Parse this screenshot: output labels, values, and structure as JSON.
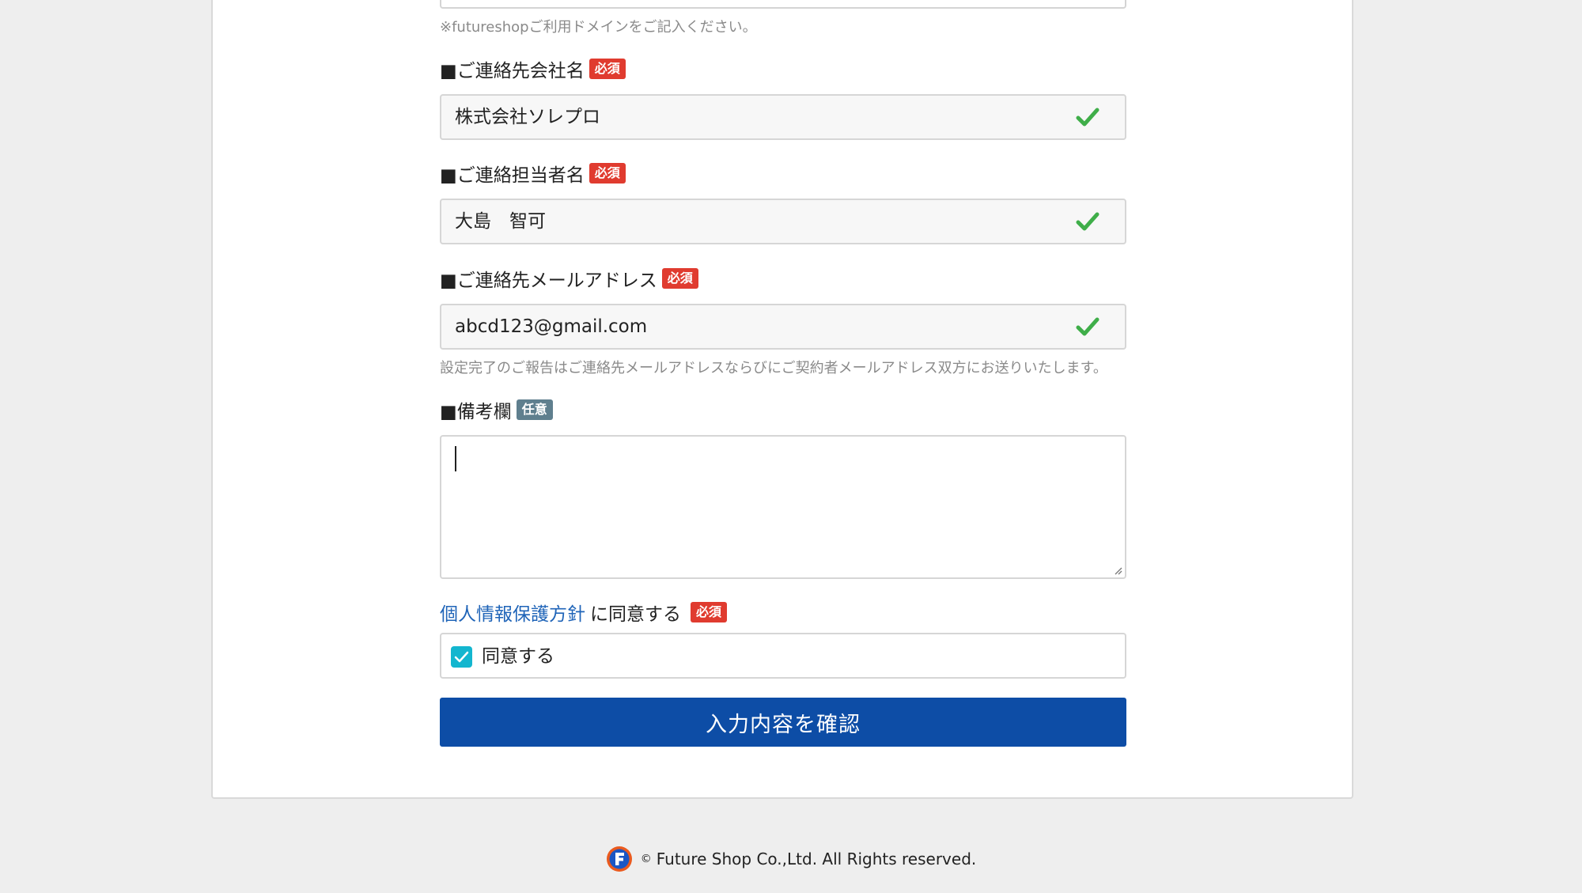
{
  "domain_note": {
    "text": "※futureshopご利用ドメインをご記入ください。"
  },
  "company": {
    "label": "■ご連絡先会社名",
    "badge": "必須",
    "value": "株式会社ソレプロ"
  },
  "contact_person": {
    "label": "■ご連絡担当者名",
    "badge": "必須",
    "value": "大島　智可"
  },
  "email": {
    "label": "■ご連絡先メールアドレス",
    "badge": "必須",
    "value": "abcd123@gmail.com",
    "note": "設定完了のご報告はご連絡先メールアドレスならびにご契約者メールアドレス双方にお送りいたします。"
  },
  "remarks": {
    "label": "■備考欄",
    "badge": "任意",
    "value": ""
  },
  "privacy": {
    "link_text": "個人情報保護方針",
    "suffix": "に同意する",
    "badge": "必須",
    "checkbox_label": "同意する",
    "checked": true
  },
  "submit": {
    "label": "入力内容を確認"
  },
  "footer": {
    "copyright_symbol": "©",
    "text": "Future Shop Co.,Ltd. All Rights reserved."
  },
  "colors": {
    "required_badge": "#e03b2f",
    "optional_badge": "#5f7f8e",
    "valid_check": "#3fae49",
    "link": "#1f64b8",
    "checkbox": "#13b6cf",
    "submit_button": "#0d4da6",
    "page_background": "#eeeeee"
  },
  "icons": {
    "valid": "checkmark-icon",
    "checkbox": "checkbox-checked-icon",
    "footer_logo": "futureshop-logo-icon"
  }
}
